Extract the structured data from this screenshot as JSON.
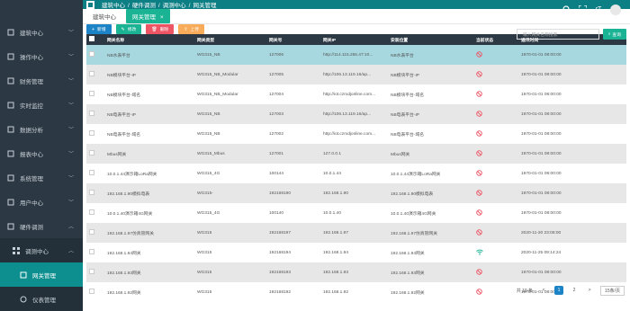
{
  "sidebar": {
    "items": [
      {
        "label": "建筑中心"
      },
      {
        "label": "操作中心"
      },
      {
        "label": "财务管理"
      },
      {
        "label": "实时监控"
      },
      {
        "label": "数据分析"
      },
      {
        "label": "报表中心"
      },
      {
        "label": "系统管理"
      },
      {
        "label": "用户中心"
      },
      {
        "label": "硬件调测"
      }
    ],
    "sub": {
      "label": "调测中心"
    },
    "sub_items": [
      {
        "label": "网关管理"
      },
      {
        "label": "仪表管理"
      }
    ]
  },
  "topbar": {
    "breadcrumb": [
      "建筑中心",
      "硬件调测",
      "调测中心",
      "网关管理"
    ],
    "avatar_text": "rT"
  },
  "tabs": [
    {
      "label": "建筑中心"
    },
    {
      "label": "网关管理"
    }
  ],
  "toolbar": {
    "add": "新增",
    "edit": "修改",
    "delete": "删除",
    "upload": "上传",
    "search_placeholder": "输入网关名称搜索",
    "search": "查询"
  },
  "table": {
    "columns": [
      "网关名称",
      "网关类型",
      "网关号",
      "网关IP",
      "安装位置",
      "当前状态",
      "通讯时间"
    ],
    "rows": [
      [
        "NB水表平台",
        "WG315_NB",
        "127006",
        "http://114.115.255.47:10...",
        "NB水表平台",
        "off",
        "1970-01-01 08:00:00"
      ],
      [
        "NB模块平台-IP",
        "WG315_NB_Modular",
        "127005",
        "http://106.13.119.16/ap...",
        "NB模块平台-IP",
        "off",
        "1970-01-01 08:00:00"
      ],
      [
        "NB模块平台-域名",
        "WG315_NB_Modular",
        "127004",
        "http://iot.czrxdjonline.com...",
        "NB模块平台-域名",
        "off",
        "1970-01-01 08:00:00"
      ],
      [
        "NB电表平台-IP",
        "WG315_NB",
        "127003",
        "http://106.13.119.16/ap...",
        "NB电表平台-IP",
        "off",
        "1970-01-01 08:00:00"
      ],
      [
        "NB电表平台-域名",
        "WG315_NB",
        "127002",
        "http://iot.czrxdjonline.com...",
        "NB电表平台-域名",
        "off",
        "1970-01-01 08:00:00"
      ],
      [
        "Mbus网关",
        "WG315_Mbus",
        "127001",
        "127.0.0.1",
        "Mbus网关",
        "off",
        "1970-01-01 08:00:00"
      ],
      [
        "10.0.1.44演示箱LoRa网关",
        "WG315_4G",
        "100144",
        "10.0.1.44",
        "10.0.1.44演示箱LoRa网关",
        "off",
        "1970-01-01 08:00:00"
      ],
      [
        "192.168.1.90模拟电表",
        "WG315-",
        "192168190",
        "192.168.1.90",
        "192.168.1.90模拟电表",
        "off",
        "1970-01-01 08:00:00"
      ],
      [
        "10.0.1.40演示箱4G网关",
        "WG315_4G",
        "100140",
        "10.0.1.40",
        "10.0.1.40演示箱4G网关",
        "off",
        "1970-01-01 08:00:00"
      ],
      [
        "192.168.1.97仿真管网关",
        "WG315",
        "192168197",
        "192.168.1.97",
        "192.168.1.97仿真管网关",
        "off",
        "2020-11-20 23:08:00"
      ],
      [
        "192.168.1.94网关",
        "WG315",
        "192168194",
        "192.168.1.94",
        "192.168.1.94网关",
        "on",
        "2020-11-25 09:14:24"
      ],
      [
        "192.168.1.93网关",
        "WG315",
        "192168193",
        "192.168.1.93",
        "192.168.1.93网关",
        "off",
        "1970-01-01 08:00:00"
      ],
      [
        "192.168.1.92网关",
        "WG315",
        "192168192",
        "192.168.1.92",
        "192.168.1.92网关",
        "off",
        "1970-01-01 08:00:00"
      ]
    ]
  },
  "pagination": {
    "total": "共 19 条",
    "prev": "<",
    "page1": "1",
    "page2": "2",
    "next": ">",
    "per_page": "15条/页"
  },
  "colors": {
    "sidebar": "#2c3843",
    "topbar": "#0c7f85",
    "accent": "#1ab394",
    "status_off": "#ed5565",
    "status_on": "#1ab394"
  }
}
